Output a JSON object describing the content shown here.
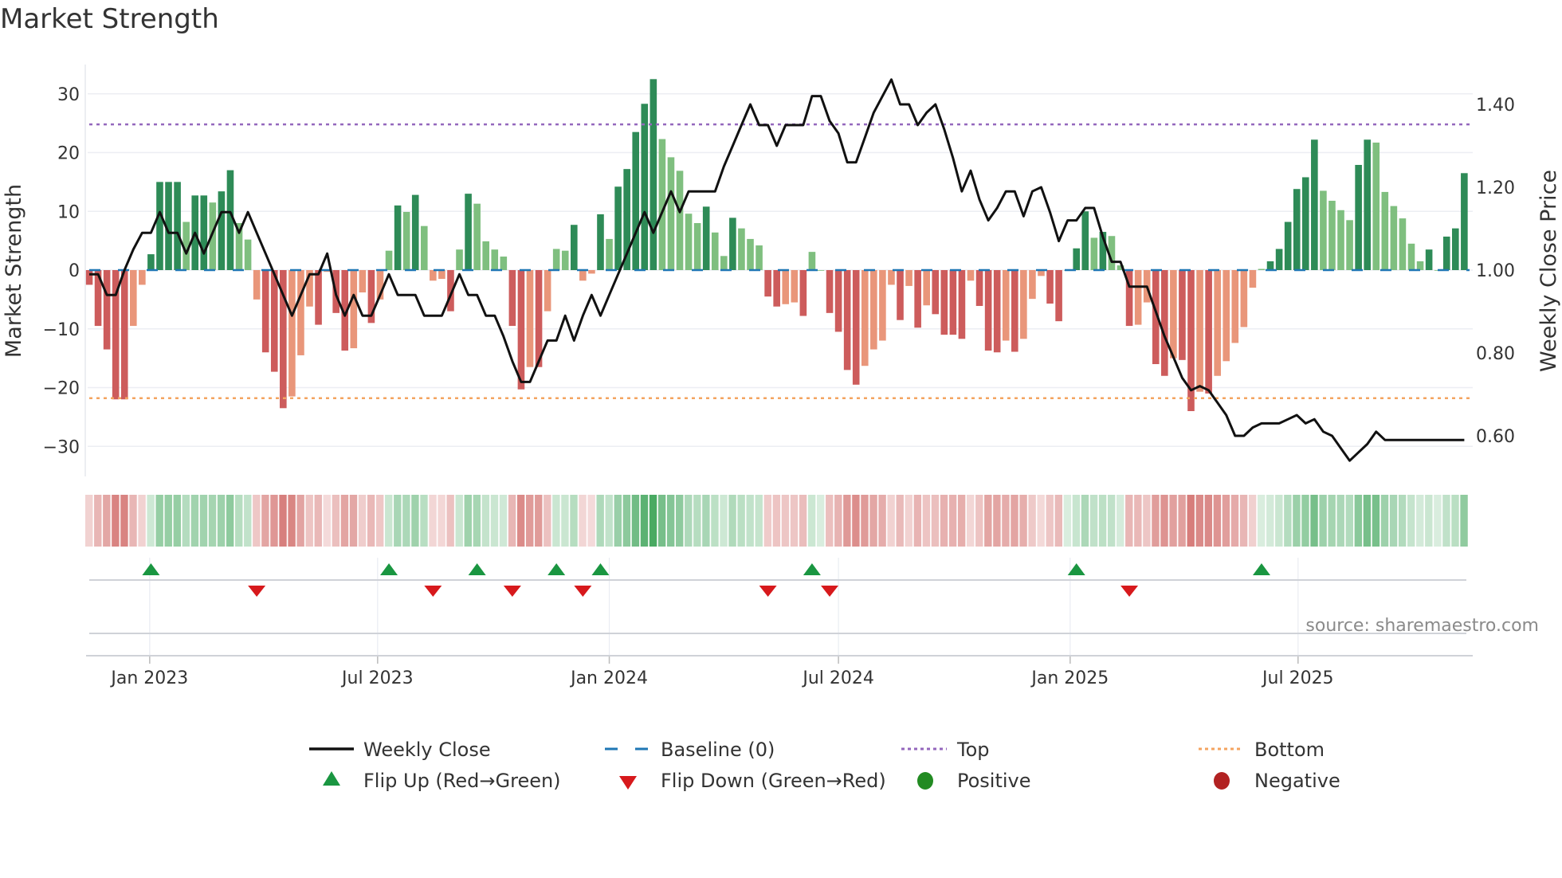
{
  "chart_data": {
    "type": "bar",
    "title": "Market Strength",
    "ylabel": "Market Strength",
    "y2label": "Weekly Close Price",
    "ylim": [
      -35,
      35
    ],
    "y2lim": [
      0.52,
      1.5
    ],
    "yticks": [
      "30",
      "20",
      "10",
      "0",
      "−10",
      "−20",
      "−30"
    ],
    "ytick_values": [
      30,
      20,
      10,
      0,
      -10,
      -20,
      -30
    ],
    "y2ticks": [
      "1.40",
      "1.20",
      "1.00",
      "0.80",
      "0.60"
    ],
    "y2tick_values": [
      1.4,
      1.2,
      1.0,
      0.8,
      0.6
    ],
    "xticks": [
      {
        "label": "Jan 2023",
        "date": "2023-01-01"
      },
      {
        "label": "Jul 2023",
        "date": "2023-07-01"
      },
      {
        "label": "Jan 2024",
        "date": "2024-01-01"
      },
      {
        "label": "Jul 2024",
        "date": "2024-07-01"
      },
      {
        "label": "Jan 2025",
        "date": "2025-01-01"
      },
      {
        "label": "Jul 2025",
        "date": "2025-07-01"
      }
    ],
    "start_date": "2022-11-14",
    "interval_days": 7,
    "strength": [
      -2.5,
      -9.5,
      -13.5,
      -22,
      -22,
      -9.5,
      -2.5,
      2.7,
      15,
      15,
      15,
      8.2,
      12.7,
      12.7,
      11.5,
      13.4,
      17,
      8,
      5.2,
      -5,
      -14,
      -17.3,
      -23.5,
      -21.5,
      -14.5,
      -6.2,
      -9.3,
      -0.3,
      -7.3,
      -13.7,
      -13.3,
      -3.8,
      -9,
      -5,
      3.3,
      11,
      9.9,
      12.8,
      7.5,
      -1.8,
      -1.5,
      -7,
      3.5,
      13,
      11.3,
      4.9,
      3.5,
      2.3,
      -9.5,
      -20.3,
      -16.5,
      -16.5,
      -7,
      3.6,
      3.3,
      7.7,
      -1.8,
      -0.6,
      9.5,
      5.3,
      14.2,
      17.2,
      23.5,
      28.3,
      32.5,
      22.3,
      19.2,
      16.9,
      9.6,
      8,
      10.8,
      6.4,
      2.4,
      8.9,
      7.1,
      5.3,
      4.2,
      -4.5,
      -6.2,
      -5.8,
      -5.5,
      -7.8,
      3.1,
      0,
      -7.3,
      -10.5,
      -17,
      -19.5,
      -16.3,
      -13.5,
      -12,
      -2.5,
      -8.5,
      -2.7,
      -9.8,
      -6,
      -7.5,
      -11,
      -11,
      -11.7,
      -1.8,
      -6.1,
      -13.7,
      -14,
      -12,
      -13.9,
      -11.7,
      -4.9,
      -1,
      -5.7,
      -8.7,
      0,
      3.7,
      10,
      5.5,
      6.5,
      5.8,
      0.8,
      -9.5,
      -9.3,
      -5.5,
      -16,
      -18,
      -15,
      -15.3,
      -24,
      -20.7,
      -21,
      -18,
      -15.5,
      -12.4,
      -9.7,
      -3,
      0.2,
      1.5,
      3.6,
      8.2,
      13.8,
      15.8,
      22.2,
      13.5,
      11.8,
      10.2,
      8.5,
      17.9,
      22.2,
      21.7,
      13.3,
      10.9,
      8.8,
      4.5,
      1.5,
      3.5,
      0,
      5.7,
      7.1,
      16.5
    ],
    "weekly_close": [
      0.99,
      0.99,
      0.94,
      0.94,
      1.0,
      1.05,
      1.09,
      1.09,
      1.14,
      1.09,
      1.09,
      1.04,
      1.09,
      1.04,
      1.09,
      1.14,
      1.14,
      1.09,
      1.14,
      1.09,
      1.04,
      0.99,
      0.94,
      0.89,
      0.94,
      0.99,
      0.99,
      1.04,
      0.94,
      0.89,
      0.94,
      0.89,
      0.89,
      0.94,
      0.99,
      0.94,
      0.94,
      0.94,
      0.89,
      0.89,
      0.89,
      0.94,
      0.99,
      0.94,
      0.94,
      0.89,
      0.89,
      0.84,
      0.78,
      0.73,
      0.73,
      0.78,
      0.83,
      0.83,
      0.89,
      0.83,
      0.89,
      0.94,
      0.89,
      0.94,
      0.99,
      1.04,
      1.09,
      1.14,
      1.09,
      1.14,
      1.19,
      1.14,
      1.19,
      1.19,
      1.19,
      1.19,
      1.25,
      1.3,
      1.35,
      1.4,
      1.35,
      1.35,
      1.3,
      1.35,
      1.35,
      1.35,
      1.42,
      1.42,
      1.36,
      1.33,
      1.26,
      1.26,
      1.32,
      1.38,
      1.42,
      1.46,
      1.4,
      1.4,
      1.35,
      1.38,
      1.4,
      1.34,
      1.27,
      1.19,
      1.24,
      1.17,
      1.12,
      1.15,
      1.19,
      1.19,
      1.13,
      1.19,
      1.2,
      1.14,
      1.07,
      1.12,
      1.12,
      1.15,
      1.15,
      1.08,
      1.02,
      1.02,
      0.96,
      0.96,
      0.96,
      0.9,
      0.84,
      0.79,
      0.74,
      0.71,
      0.72,
      0.71,
      0.68,
      0.65,
      0.6,
      0.6,
      0.62,
      0.63,
      0.63,
      0.63,
      0.64,
      0.65,
      0.63,
      0.64,
      0.61,
      0.6,
      0.57,
      0.54,
      0.56,
      0.58,
      0.61,
      0.59,
      0.59,
      0.59,
      0.59,
      0.59,
      0.59,
      0.59,
      0.59,
      0.59,
      0.59
    ],
    "top_level": 24.8,
    "bottom_level": -21.8,
    "baseline": 0,
    "flip_up_dates": [
      "2023-01-02",
      "2023-07-10",
      "2023-09-18",
      "2023-11-20",
      "2023-12-25",
      "2024-06-10",
      "2025-01-06",
      "2025-06-02"
    ],
    "flip_down_dates": [
      "2023-03-27",
      "2023-08-14",
      "2023-10-16",
      "2023-12-11",
      "2024-05-06",
      "2024-06-24",
      "2025-02-17"
    ],
    "legend": {
      "weekly_close": "Weekly Close",
      "baseline": "Baseline (0)",
      "top": "Top",
      "bottom": "Bottom",
      "flip_up": "Flip Up (Red→Green)",
      "flip_down": "Flip Down (Green→Red)",
      "positive": "Positive",
      "negative": "Negative"
    },
    "legend_placement": "bottom",
    "source": "source: sharemaestro.com",
    "colors": {
      "pos_strong": "#2e8b57",
      "pos_weak": "#7fbf7f",
      "neg_strong": "#cd5c5c",
      "neg_weak": "#e9967a",
      "line": "#111111",
      "baseline": "#1f77b4",
      "top": "#9467bd",
      "bottom": "#f4a460",
      "flip_up": "#1a9641",
      "flip_down": "#d7191c",
      "positive": "#228b22",
      "negative": "#b22222"
    }
  }
}
